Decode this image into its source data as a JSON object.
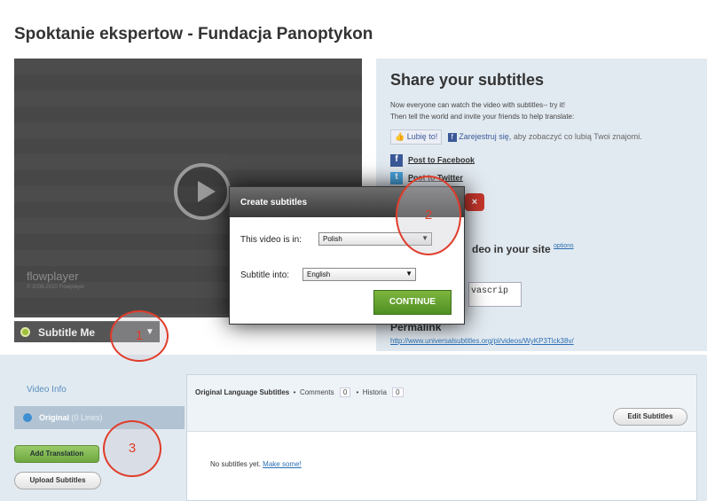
{
  "page": {
    "title": "Spoktanie ekspertow - Fundacja Panoptykon"
  },
  "player": {
    "brand": "flowplayer",
    "copyright": "© 2008-2010 Flowplayer",
    "subtitle_menu_label": "Subtitle Me"
  },
  "share": {
    "heading": "Share your subtitles",
    "desc_line1": "Now everyone can watch the video with subtitles-- try it!",
    "desc_line2": "Then tell the world and invite your friends to help translate:",
    "like_label": "Lubię to!",
    "register_link": "Zarejestruj się,",
    "register_text": "aby zobaczyć co lubią Twoi znajomi.",
    "post_facebook": "Post to Facebook",
    "post_twitter": "Post to Twitter",
    "embed_heading": "deo in your site",
    "embed_options": "options",
    "embed_code": "vascrip",
    "permalink_heading": "Permalink",
    "permalink_url": "http://www.universalsubtitles.org/pl/videos/WyKP3Tlck38v/"
  },
  "modal": {
    "title": "Create subtitles",
    "video_is_in_label": "This video is in:",
    "video_language": "Polish",
    "subtitle_into_label": "Subtitle into:",
    "subtitle_language": "English",
    "continue_label": "CONTINUE",
    "close_label": "×"
  },
  "sidebar": {
    "video_info": "Video Info",
    "original_label": "Original",
    "original_lines": "(0 Lines)",
    "add_translation": "Add Translation",
    "upload_subtitles": "Upload Subtitles"
  },
  "subtitles_panel": {
    "tab_original": "Original Language Subtitles",
    "tab_comments": "Comments",
    "comments_count": "0",
    "tab_history": "Historia",
    "history_count": "0",
    "edit_button": "Edit Subtitles",
    "empty_text": "No subtitles yet.",
    "make_some": "Make some!"
  },
  "annotations": {
    "one": "1",
    "two": "2",
    "three": "3"
  },
  "colors": {
    "accent_green": "#6ea83f",
    "close_red": "#c8372d",
    "annotation_red": "#e03c2a"
  }
}
